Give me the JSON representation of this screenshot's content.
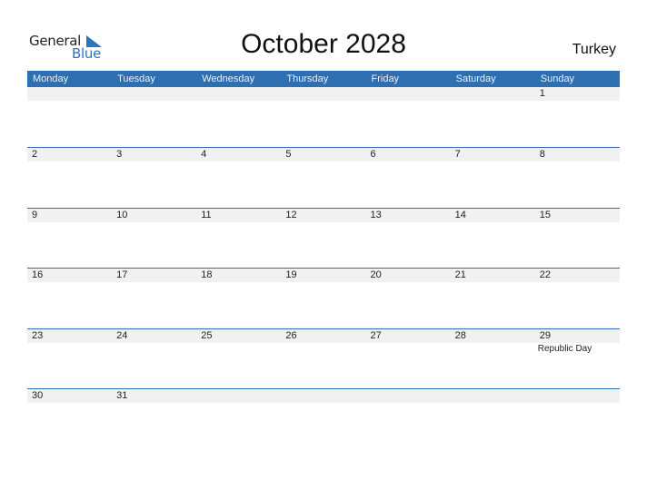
{
  "logo": {
    "general": "General",
    "blue": "Blue"
  },
  "title": "October 2028",
  "country": "Turkey",
  "weekdays": [
    "Monday",
    "Tuesday",
    "Wednesday",
    "Thursday",
    "Friday",
    "Saturday",
    "Sunday"
  ],
  "weeks": [
    {
      "days": [
        "",
        "",
        "",
        "",
        "",
        "",
        "1"
      ],
      "holidays": [
        "",
        "",
        "",
        "",
        "",
        "",
        ""
      ]
    },
    {
      "days": [
        "2",
        "3",
        "4",
        "5",
        "6",
        "7",
        "8"
      ],
      "holidays": [
        "",
        "",
        "",
        "",
        "",
        "",
        ""
      ]
    },
    {
      "days": [
        "9",
        "10",
        "11",
        "12",
        "13",
        "14",
        "15"
      ],
      "holidays": [
        "",
        "",
        "",
        "",
        "",
        "",
        ""
      ]
    },
    {
      "days": [
        "16",
        "17",
        "18",
        "19",
        "20",
        "21",
        "22"
      ],
      "holidays": [
        "",
        "",
        "",
        "",
        "",
        "",
        ""
      ]
    },
    {
      "days": [
        "23",
        "24",
        "25",
        "26",
        "27",
        "28",
        "29"
      ],
      "holidays": [
        "",
        "",
        "",
        "",
        "",
        "",
        "Republic Day"
      ]
    },
    {
      "days": [
        "30",
        "31",
        "",
        "",
        "",
        "",
        ""
      ],
      "holidays": [
        "",
        "",
        "",
        "",
        "",
        "",
        ""
      ]
    }
  ],
  "colors": {
    "header": "#2e6fb2",
    "strip": "#f1f1f1",
    "brand_blue": "#2a75bb"
  }
}
